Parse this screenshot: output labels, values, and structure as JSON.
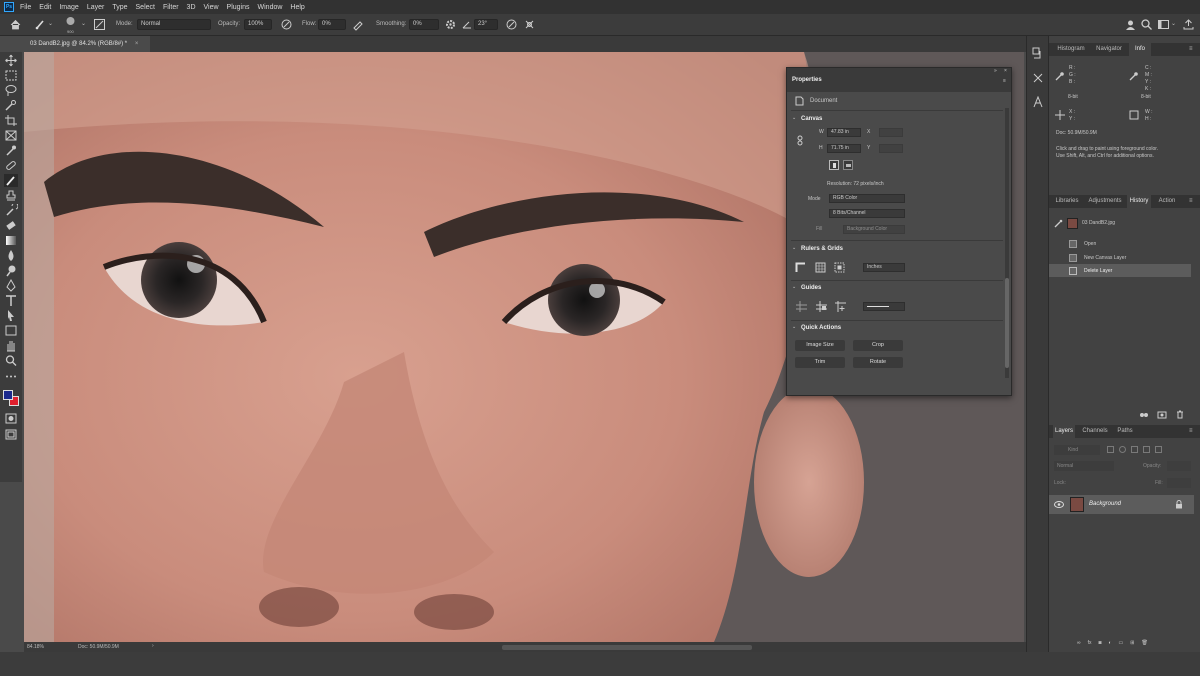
{
  "menubar": {
    "logo": "Ps",
    "items": [
      "File",
      "Edit",
      "Image",
      "Layer",
      "Type",
      "Select",
      "Filter",
      "3D",
      "View",
      "Plugins",
      "Window",
      "Help"
    ]
  },
  "options": {
    "brush_size": "900",
    "mode_label": "Mode:",
    "mode_value": "Normal",
    "opacity_label": "Opacity:",
    "opacity_value": "100%",
    "flow_label": "Flow:",
    "flow_value": "0%",
    "smoothing_label": "Smoothing:",
    "smoothing_value": "0%",
    "angle_value": "23°"
  },
  "document": {
    "tab_title": "03 DandB2.jpg @ 84.2% (RGB/8#) *",
    "zoom": "84.18%",
    "doc_size": "Doc: 50.9M/50.9M"
  },
  "properties": {
    "title": "Properties",
    "document_label": "Document",
    "canvas_header": "Canvas",
    "w_label": "W",
    "w_value": "47.83 in",
    "h_label": "H",
    "h_value": "71.75 in",
    "x_label": "X",
    "y_label": "Y",
    "resolution": "Resolution: 72 pixels/inch",
    "mode_label": "Mode",
    "mode_value": "RGB Color",
    "depth_value": "8 Bits/Channel",
    "fill_label": "Fill",
    "fill_value": "Background Color",
    "rulers_header": "Rulers & Grids",
    "units_value": "Inches",
    "guides_header": "Guides",
    "quick_header": "Quick Actions",
    "btn_image_size": "Image Size",
    "btn_crop": "Crop",
    "btn_trim": "Trim",
    "btn_rotate": "Rotate"
  },
  "info_panel": {
    "tabs": [
      "Histogram",
      "Navigator",
      "Info"
    ],
    "rgb_labels": [
      "R :",
      "G :",
      "B :"
    ],
    "cmyk_labels": [
      "C :",
      "M :",
      "Y :",
      "K :"
    ],
    "bit_left": "8-bit",
    "bit_right": "8-bit",
    "xy_labels": [
      "X :",
      "Y :"
    ],
    "wh_labels": [
      "W :",
      "H :"
    ],
    "doc": "Doc: 50.9M/50.9M",
    "hint_line1": "Click and drag to paint using foreground color.",
    "hint_line2": "Use Shift, Alt, and Ctrl for additional options."
  },
  "history_panel": {
    "tabs": [
      "Libraries",
      "Adjustments",
      "History",
      "Action"
    ],
    "snapshot": "03 DandB2.jpg",
    "items": [
      "Open",
      "New Canvas Layer",
      "Delete Layer"
    ]
  },
  "layers_panel": {
    "tabs": [
      "Layers",
      "Channels",
      "Paths"
    ],
    "kind_label": "Kind",
    "blend_mode": "Normal",
    "opacity_label": "Opacity:",
    "fill_label": "Fill:",
    "lock_label": "Lock:",
    "layer_name": "Background"
  },
  "colors": {
    "foreground": "#1c2a8c",
    "background": "#e0202e",
    "accent": "#31a8ff"
  }
}
